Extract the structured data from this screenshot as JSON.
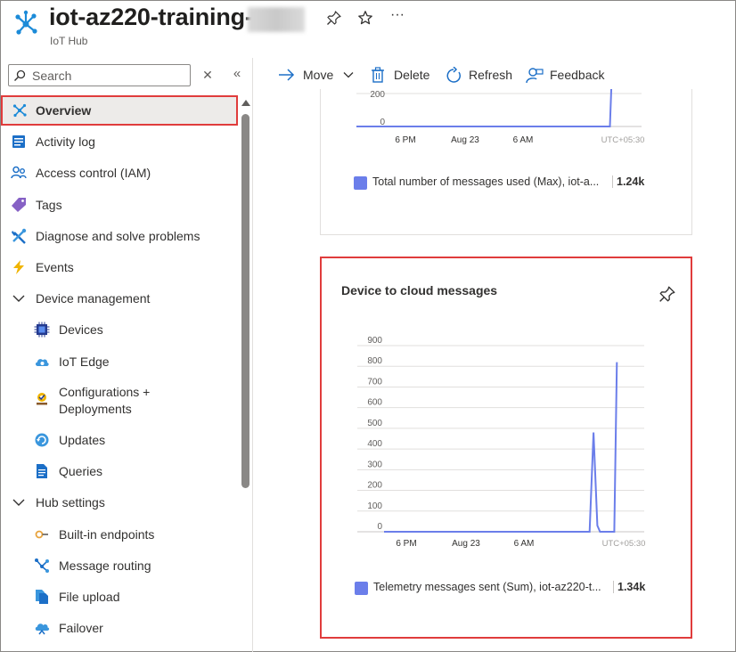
{
  "header": {
    "title": "iot-az220-training-",
    "subtitle": "IoT Hub",
    "icons": [
      "iot-hub-icon",
      "pin-icon",
      "star-icon",
      "more-icon"
    ]
  },
  "search": {
    "placeholder": "Search",
    "value": ""
  },
  "sidebar": {
    "items": [
      {
        "label": "Overview",
        "icon": "overview-icon",
        "selected": true
      },
      {
        "label": "Activity log",
        "icon": "activity-log-icon"
      },
      {
        "label": "Access control (IAM)",
        "icon": "access-control-icon"
      },
      {
        "label": "Tags",
        "icon": "tag-icon"
      },
      {
        "label": "Diagnose and solve problems",
        "icon": "wrench-icon"
      },
      {
        "label": "Events",
        "icon": "lightning-icon"
      },
      {
        "label": "Device management",
        "icon": "chevron-down-icon",
        "expanded": true
      },
      {
        "label": "Devices",
        "icon": "chip-icon"
      },
      {
        "label": "IoT Edge",
        "icon": "cloud-icon"
      },
      {
        "label": "Configurations +",
        "label2": "Deployments",
        "icon": "configurations-icon"
      },
      {
        "label": "Updates",
        "icon": "updates-icon"
      },
      {
        "label": "Queries",
        "icon": "document-icon"
      },
      {
        "label": "Hub settings",
        "icon": "chevron-down-icon",
        "expanded": true
      },
      {
        "label": "Built-in endpoints",
        "icon": "endpoint-icon"
      },
      {
        "label": "Message routing",
        "icon": "routing-icon"
      },
      {
        "label": "File upload",
        "icon": "file-upload-icon"
      },
      {
        "label": "Failover",
        "icon": "failover-icon"
      }
    ]
  },
  "toolbar": {
    "move": "Move",
    "delete": "Delete",
    "refresh": "Refresh",
    "feedback": "Feedback"
  },
  "tiles": [
    {
      "chart_data": {
        "type": "line",
        "title": "",
        "x_ticks": [
          "6 PM",
          "Aug 23",
          "6 AM"
        ],
        "timezone": "UTC+05:30",
        "y_ticks": [
          0,
          200
        ],
        "series": [
          {
            "name": "Total number of messages used (Max), iot-a...",
            "summary": "1.24k",
            "color": "#6b7eea",
            "points": [
              [
                0,
                0
              ],
              [
                0.9,
                0
              ],
              [
                0.93,
                0
              ],
              [
                0.94,
                1240
              ]
            ]
          }
        ]
      }
    },
    {
      "chart_data": {
        "type": "line",
        "title": "Device to cloud messages",
        "x_ticks": [
          "6 PM",
          "Aug 23",
          "6 AM"
        ],
        "timezone": "UTC+05:30",
        "y_ticks": [
          0,
          100,
          200,
          300,
          400,
          500,
          600,
          700,
          800,
          900
        ],
        "ylim": [
          0,
          900
        ],
        "series": [
          {
            "name": "Telemetry messages sent (Sum), iot-az220-t...",
            "summary": "1.34k",
            "color": "#6b7eea",
            "points": [
              [
                0,
                0
              ],
              [
                0.79,
                0
              ],
              [
                0.805,
                480
              ],
              [
                0.82,
                30
              ],
              [
                0.83,
                0
              ],
              [
                0.885,
                0
              ],
              [
                0.895,
                820
              ]
            ]
          }
        ]
      }
    }
  ]
}
